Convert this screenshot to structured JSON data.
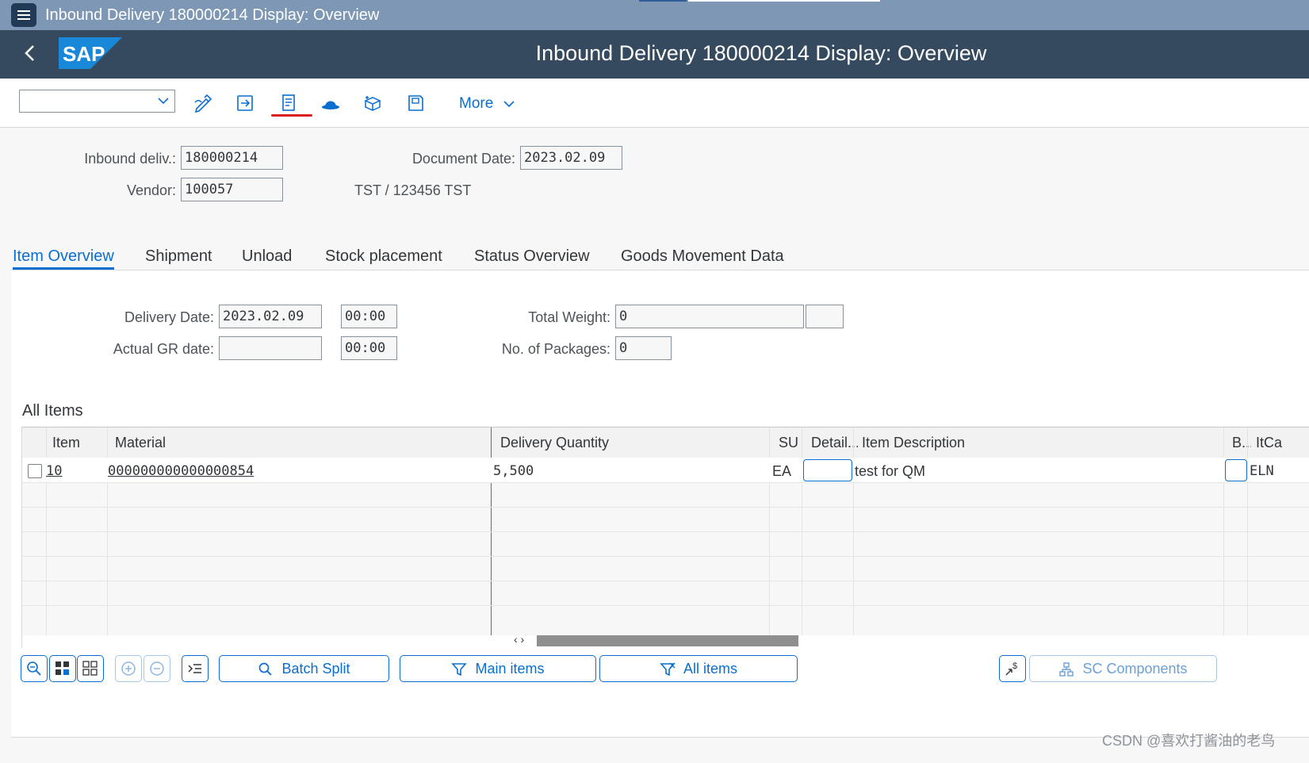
{
  "window": {
    "title": "Inbound Delivery 180000214 Display: Overview"
  },
  "shell": {
    "title": "Inbound Delivery 180000214 Display: Overview",
    "logo_text": "SAP"
  },
  "toolbar": {
    "dropdown_value": "",
    "more_label": "More",
    "icons": [
      "edit-icon",
      "display-change-icon",
      "document-icon",
      "hat-icon",
      "package-icon",
      "print-preview-icon"
    ]
  },
  "header": {
    "inbound_label": "Inbound deliv.:",
    "inbound_value": "180000214",
    "docdate_label": "Document Date:",
    "docdate_value": "2023.02.09",
    "vendor_label": "Vendor:",
    "vendor_value": "100057",
    "vendor_name": "TST / 123456 TST"
  },
  "tabs": [
    {
      "label": "Item Overview",
      "active": true
    },
    {
      "label": "Shipment"
    },
    {
      "label": "Unload"
    },
    {
      "label": "Stock placement"
    },
    {
      "label": "Status Overview"
    },
    {
      "label": "Goods Movement Data"
    }
  ],
  "overview": {
    "delivery_date_label": "Delivery Date:",
    "delivery_date_value": "2023.02.09",
    "delivery_time_value": "00:00",
    "gr_date_label": "Actual GR date:",
    "gr_date_value": "",
    "gr_time_value": "00:00",
    "total_weight_label": "Total Weight:",
    "total_weight_value": "0",
    "total_weight_unit": "",
    "packages_label": "No. of Packages:",
    "packages_value": "0"
  },
  "items": {
    "section_title": "All Items",
    "columns": [
      "Item",
      "Material",
      "Delivery Quantity",
      "SU",
      "Detail...",
      "Item Description",
      "B...",
      "ItCa"
    ],
    "rows": [
      {
        "item": "10",
        "material": "000000000000000854",
        "quantity": "5,500",
        "su": "EA",
        "detail": "",
        "description": "test for QM",
        "b": "",
        "itca": "ELN"
      }
    ]
  },
  "buttons": {
    "batch_split": "Batch Split",
    "main_items": "Main items",
    "all_items": "All items",
    "sc_components": "SC Components"
  },
  "watermark": "CSDN @喜欢打酱油的老鸟",
  "colors": {
    "shell": "#354a5f",
    "accent": "#0a6ed1",
    "window_bar": "#7d97b4"
  }
}
